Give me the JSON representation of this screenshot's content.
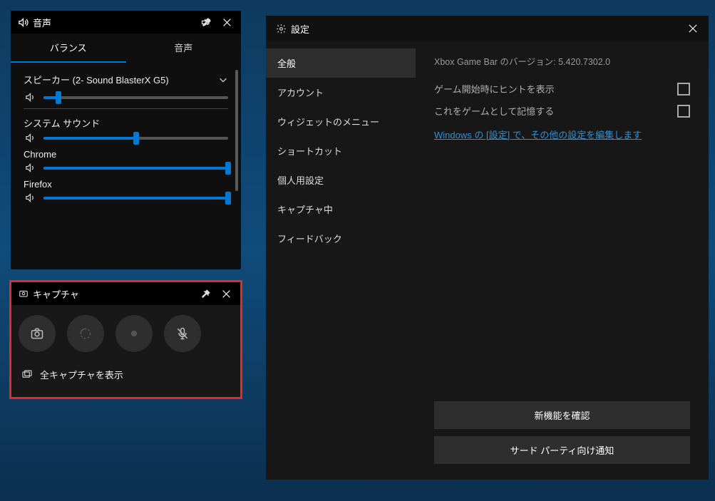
{
  "audio": {
    "title": "音声",
    "tabs": {
      "balance": "バランス",
      "audio": "音声"
    },
    "device": "スピーカー (2- Sound BlasterX G5)",
    "sliders": {
      "master": {
        "value": 8
      },
      "system": {
        "label": "システム サウンド",
        "value": 50
      },
      "chrome": {
        "label": "Chrome",
        "value": 100
      },
      "firefox": {
        "label": "Firefox",
        "value": 100
      }
    }
  },
  "capture": {
    "title": "キャプチャ",
    "show_all": "全キャプチャを表示"
  },
  "settings": {
    "title": "設定",
    "version_prefix": "Xbox Game Bar のバージョン: ",
    "version": "5.420.7302.0",
    "nav": {
      "general": "全般",
      "account": "アカウント",
      "widget_menu": "ウィジェットのメニュー",
      "shortcuts": "ショートカット",
      "personalization": "個人用設定",
      "capturing": "キャプチャ中",
      "feedback": "フィードバック"
    },
    "options": {
      "show_tips": "ゲーム開始時にヒントを表示",
      "remember_game": "これをゲームとして記憶する"
    },
    "link": "Windows の [設定] で、その他の設定を編集します",
    "buttons": {
      "whats_new": "新機能を確認",
      "third_party": "サード パーティ向け通知"
    }
  }
}
